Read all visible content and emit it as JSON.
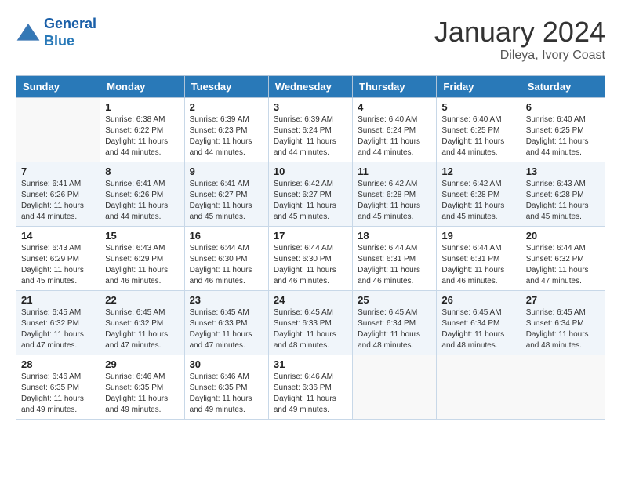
{
  "header": {
    "logo_line1": "General",
    "logo_line2": "Blue",
    "month_year": "January 2024",
    "location": "Dileya, Ivory Coast"
  },
  "days_of_week": [
    "Sunday",
    "Monday",
    "Tuesday",
    "Wednesday",
    "Thursday",
    "Friday",
    "Saturday"
  ],
  "weeks": [
    [
      {
        "day": "",
        "info": ""
      },
      {
        "day": "1",
        "info": "Sunrise: 6:38 AM\nSunset: 6:22 PM\nDaylight: 11 hours\nand 44 minutes."
      },
      {
        "day": "2",
        "info": "Sunrise: 6:39 AM\nSunset: 6:23 PM\nDaylight: 11 hours\nand 44 minutes."
      },
      {
        "day": "3",
        "info": "Sunrise: 6:39 AM\nSunset: 6:24 PM\nDaylight: 11 hours\nand 44 minutes."
      },
      {
        "day": "4",
        "info": "Sunrise: 6:40 AM\nSunset: 6:24 PM\nDaylight: 11 hours\nand 44 minutes."
      },
      {
        "day": "5",
        "info": "Sunrise: 6:40 AM\nSunset: 6:25 PM\nDaylight: 11 hours\nand 44 minutes."
      },
      {
        "day": "6",
        "info": "Sunrise: 6:40 AM\nSunset: 6:25 PM\nDaylight: 11 hours\nand 44 minutes."
      }
    ],
    [
      {
        "day": "7",
        "info": "Sunrise: 6:41 AM\nSunset: 6:26 PM\nDaylight: 11 hours\nand 44 minutes."
      },
      {
        "day": "8",
        "info": "Sunrise: 6:41 AM\nSunset: 6:26 PM\nDaylight: 11 hours\nand 44 minutes."
      },
      {
        "day": "9",
        "info": "Sunrise: 6:41 AM\nSunset: 6:27 PM\nDaylight: 11 hours\nand 45 minutes."
      },
      {
        "day": "10",
        "info": "Sunrise: 6:42 AM\nSunset: 6:27 PM\nDaylight: 11 hours\nand 45 minutes."
      },
      {
        "day": "11",
        "info": "Sunrise: 6:42 AM\nSunset: 6:28 PM\nDaylight: 11 hours\nand 45 minutes."
      },
      {
        "day": "12",
        "info": "Sunrise: 6:42 AM\nSunset: 6:28 PM\nDaylight: 11 hours\nand 45 minutes."
      },
      {
        "day": "13",
        "info": "Sunrise: 6:43 AM\nSunset: 6:28 PM\nDaylight: 11 hours\nand 45 minutes."
      }
    ],
    [
      {
        "day": "14",
        "info": "Sunrise: 6:43 AM\nSunset: 6:29 PM\nDaylight: 11 hours\nand 45 minutes."
      },
      {
        "day": "15",
        "info": "Sunrise: 6:43 AM\nSunset: 6:29 PM\nDaylight: 11 hours\nand 46 minutes."
      },
      {
        "day": "16",
        "info": "Sunrise: 6:44 AM\nSunset: 6:30 PM\nDaylight: 11 hours\nand 46 minutes."
      },
      {
        "day": "17",
        "info": "Sunrise: 6:44 AM\nSunset: 6:30 PM\nDaylight: 11 hours\nand 46 minutes."
      },
      {
        "day": "18",
        "info": "Sunrise: 6:44 AM\nSunset: 6:31 PM\nDaylight: 11 hours\nand 46 minutes."
      },
      {
        "day": "19",
        "info": "Sunrise: 6:44 AM\nSunset: 6:31 PM\nDaylight: 11 hours\nand 46 minutes."
      },
      {
        "day": "20",
        "info": "Sunrise: 6:44 AM\nSunset: 6:32 PM\nDaylight: 11 hours\nand 47 minutes."
      }
    ],
    [
      {
        "day": "21",
        "info": "Sunrise: 6:45 AM\nSunset: 6:32 PM\nDaylight: 11 hours\nand 47 minutes."
      },
      {
        "day": "22",
        "info": "Sunrise: 6:45 AM\nSunset: 6:32 PM\nDaylight: 11 hours\nand 47 minutes."
      },
      {
        "day": "23",
        "info": "Sunrise: 6:45 AM\nSunset: 6:33 PM\nDaylight: 11 hours\nand 47 minutes."
      },
      {
        "day": "24",
        "info": "Sunrise: 6:45 AM\nSunset: 6:33 PM\nDaylight: 11 hours\nand 48 minutes."
      },
      {
        "day": "25",
        "info": "Sunrise: 6:45 AM\nSunset: 6:34 PM\nDaylight: 11 hours\nand 48 minutes."
      },
      {
        "day": "26",
        "info": "Sunrise: 6:45 AM\nSunset: 6:34 PM\nDaylight: 11 hours\nand 48 minutes."
      },
      {
        "day": "27",
        "info": "Sunrise: 6:45 AM\nSunset: 6:34 PM\nDaylight: 11 hours\nand 48 minutes."
      }
    ],
    [
      {
        "day": "28",
        "info": "Sunrise: 6:46 AM\nSunset: 6:35 PM\nDaylight: 11 hours\nand 49 minutes."
      },
      {
        "day": "29",
        "info": "Sunrise: 6:46 AM\nSunset: 6:35 PM\nDaylight: 11 hours\nand 49 minutes."
      },
      {
        "day": "30",
        "info": "Sunrise: 6:46 AM\nSunset: 6:35 PM\nDaylight: 11 hours\nand 49 minutes."
      },
      {
        "day": "31",
        "info": "Sunrise: 6:46 AM\nSunset: 6:36 PM\nDaylight: 11 hours\nand 49 minutes."
      },
      {
        "day": "",
        "info": ""
      },
      {
        "day": "",
        "info": ""
      },
      {
        "day": "",
        "info": ""
      }
    ]
  ]
}
